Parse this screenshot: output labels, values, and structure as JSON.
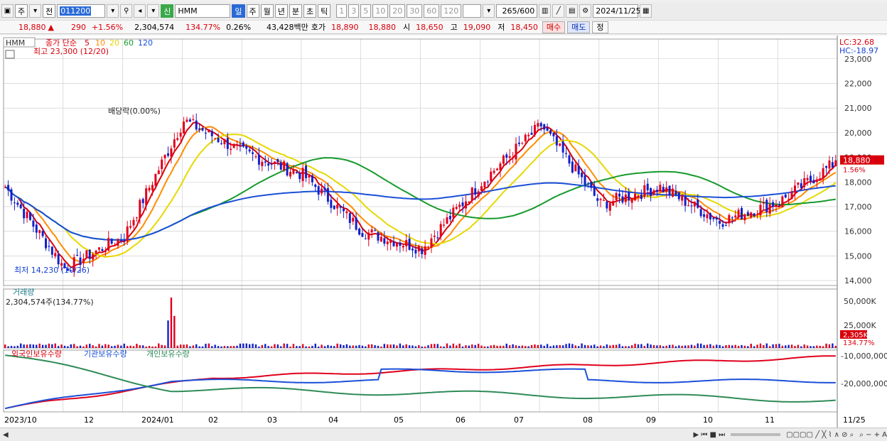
{
  "toolbar": {
    "account_type": "주",
    "prev": "전",
    "code": "011200",
    "name_badge": "신",
    "stock_name": "HMM",
    "periods": [
      "일",
      "주",
      "월",
      "년",
      "분",
      "초",
      "틱"
    ],
    "selected_period": "일",
    "intervals": [
      "1",
      "3",
      "5",
      "10",
      "20",
      "30",
      "60",
      "120"
    ],
    "count": "265",
    "count_max": "/600",
    "date": "2024/11/25"
  },
  "quote": {
    "price": "18,880",
    "arrow": "▲",
    "change": "290",
    "change_pct": "+1.56%",
    "volume": "2,304,574",
    "vol_ratio": "134.77%",
    "turnover": "0.26%",
    "amount": "43,428백만",
    "label_bid": "호가",
    "ask": "18,890",
    "bid": "18,880",
    "label_open": "시",
    "open": "18,650",
    "label_high": "고",
    "high": "19,090",
    "label_low": "저",
    "low": "18,450",
    "buy": "매수",
    "sell": "매도",
    "correction": "정"
  },
  "legend": {
    "stock": "HMM",
    "price_label": "종가 단순",
    "ma": [
      "5",
      "10",
      "20",
      "60",
      "120"
    ],
    "ma_colors": [
      "#d8000c",
      "#ff8c00",
      "#e6d800",
      "#179a2c",
      "#1a4fd8"
    ]
  },
  "annotations": {
    "high": "최고 23,300 (12/20)",
    "low": "최저 14,230 (10/26)",
    "dividend": "배당락(0.00%)",
    "lc": "LC:32.68",
    "hc": "HC:-18.97"
  },
  "colors": {
    "up": "#e0001c",
    "down": "#1220c8",
    "grid": "#c8c8c8",
    "price_tag": "#d8000c"
  },
  "volume_panel": {
    "title": "거래량",
    "current": "2,304,574주(134.77%)",
    "axis_labels": [
      "50,000K",
      "25,000K"
    ],
    "tag": "2,305K",
    "tag_pct": "134.77%"
  },
  "holdings_panel": {
    "series_names": [
      "외국인보유수량",
      "기관보유수량",
      "개인보유수량"
    ],
    "colors": [
      "#e0001c",
      "#1a4fd8",
      "#2e8b57"
    ],
    "axis_labels": [
      "-10,000,000",
      "-20,000,000"
    ]
  },
  "xaxis_labels": [
    "2023/10",
    "12",
    "2024/01",
    "02",
    "03",
    "04",
    "05",
    "06",
    "07",
    "08",
    "09",
    "10",
    "11",
    "11/25"
  ],
  "status_bar": {
    "text": "▶ ⏮ ■ ⏭"
  },
  "chart_data": {
    "type": "candlestick",
    "ylim": [
      13800,
      23800
    ],
    "yticks": [
      14000,
      15000,
      16000,
      17000,
      18000,
      19000,
      20000,
      21000,
      22000,
      23000
    ],
    "ytick_labels": [
      "14,000",
      "15,000",
      "16,000",
      "17,000",
      "18,000",
      "19,000",
      "20,000",
      "21,000",
      "22,000",
      "23,000"
    ],
    "months": [
      {
        "label": "2023/10",
        "start": 17.8,
        "end": 14.5
      },
      {
        "label": "11",
        "start": 14.5,
        "end": 15.8
      },
      {
        "label": "12",
        "start": 15.8,
        "end": 20.5
      },
      {
        "label": "2024/01",
        "start": 20.5,
        "end": 19.2
      },
      {
        "label": "02",
        "start": 19.2,
        "end": 18.3
      },
      {
        "label": "03",
        "start": 18.3,
        "end": 16.0
      },
      {
        "label": "04",
        "start": 16.0,
        "end": 15.3
      },
      {
        "label": "05",
        "start": 15.3,
        "end": 18.0
      },
      {
        "label": "06",
        "start": 18.0,
        "end": 20.3
      },
      {
        "label": "07",
        "start": 20.3,
        "end": 17.1
      },
      {
        "label": "08",
        "start": 17.1,
        "end": 17.8
      },
      {
        "label": "09",
        "start": 17.8,
        "end": 16.4
      },
      {
        "label": "10",
        "start": 16.4,
        "end": 17.2
      },
      {
        "label": "11",
        "start": 17.2,
        "end": 18.88
      }
    ],
    "last_price": 18880,
    "last_change_pct": "1.56%",
    "max_high": 23300,
    "min_low": 14230,
    "volume_max": 55000,
    "holdings_ylim": [
      -26000000,
      -8000000
    ]
  }
}
